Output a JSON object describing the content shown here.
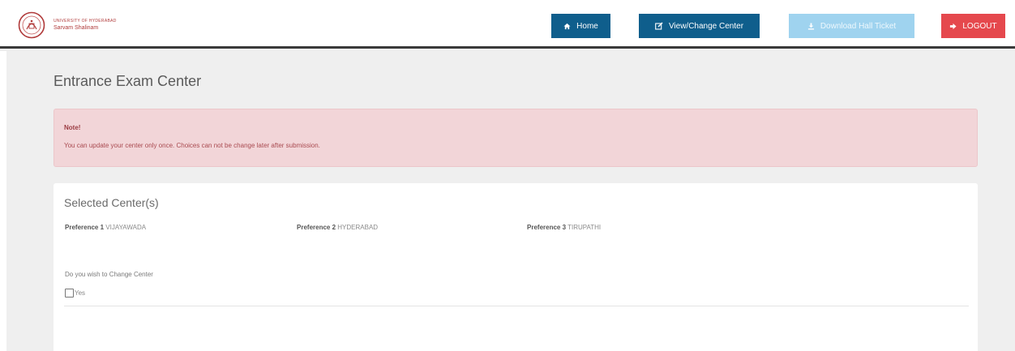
{
  "header": {
    "logo": {
      "line1": "University of Hyderabad",
      "line2": "Sarvam Shalinam"
    },
    "nav": {
      "home_label": "Home",
      "view_change_label": "View/Change Center",
      "download_label": "Download Hall Ticket",
      "logout_label": "LOGOUT"
    },
    "colors": {
      "primary": "#0f5e8c",
      "disabled": "#9fd3ef",
      "danger": "#e5484d"
    }
  },
  "main": {
    "title": "Entrance Exam Center",
    "note": {
      "title": "Note!",
      "text": "You can update your center only once. Choices can not be change later after submission."
    },
    "selected": {
      "title": "Selected Center(s)",
      "preferences": [
        {
          "label": "Preference 1",
          "value": "VIJAYAWADA"
        },
        {
          "label": "Preference 2",
          "value": "HYDERABAD"
        },
        {
          "label": "Preference 3",
          "value": "TIRUPATHI"
        }
      ],
      "change_question": "Do you wish to Change Center",
      "yes_label": "Yes",
      "yes_checked": false
    }
  }
}
